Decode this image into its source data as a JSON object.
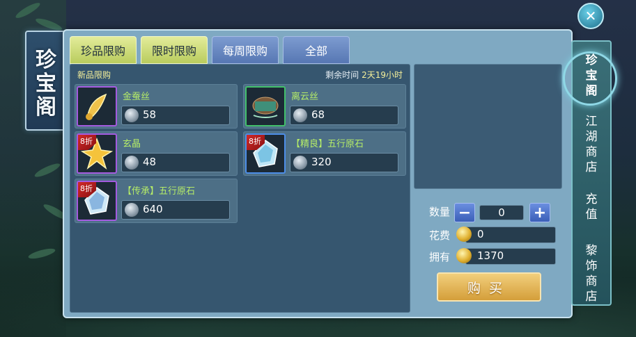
{
  "title": [
    "珍",
    "宝",
    "阁"
  ],
  "tabs": [
    {
      "label": "珍品限购",
      "active": true
    },
    {
      "label": "限时限购",
      "active": true
    },
    {
      "label": "每周限购",
      "active": false
    },
    {
      "label": "全部",
      "active": false
    }
  ],
  "list": {
    "header": "新品限购",
    "remaining_label": "剩余时间",
    "remaining_value": "2天19小时"
  },
  "items": [
    {
      "name": "金蚕丝",
      "price": "58",
      "badge": "",
      "icon": "golden-silk-icon",
      "rarity": "purple"
    },
    {
      "name": "离云丝",
      "price": "68",
      "badge": "",
      "icon": "cloud-silk-spool-icon",
      "rarity": "green"
    },
    {
      "name": "玄晶",
      "price": "48",
      "badge": "8折",
      "icon": "gold-crystal-star-icon",
      "rarity": "purple"
    },
    {
      "name": "【精良】五行原石",
      "price": "320",
      "badge": "8折",
      "icon": "blue-gem-icon",
      "rarity": "blue"
    },
    {
      "name": "【传承】五行原石",
      "price": "640",
      "badge": "8折",
      "icon": "purple-gem-icon",
      "rarity": "purple"
    }
  ],
  "purchase": {
    "qty_label": "数量",
    "qty_value": "0",
    "minus": "−",
    "plus": "+",
    "cost_label": "花费",
    "cost_value": "0",
    "own_label": "拥有",
    "own_value": "1370",
    "buy_label": "购买"
  },
  "sidenav": [
    {
      "label": [
        "珍",
        "宝",
        "阁"
      ],
      "active": true
    },
    {
      "label": [
        "江",
        "湖",
        "商",
        "店"
      ],
      "active": false
    },
    {
      "label": [
        "充",
        "值"
      ],
      "active": false
    },
    {
      "label": [
        "黎",
        "饰",
        "商",
        "店"
      ],
      "active": false
    }
  ],
  "close": "✕",
  "colors": {
    "accent_green": "#b5ec68",
    "tab_active": "#d7e285",
    "tab_normal": "#6a8acb",
    "buy_gold": "#e3b65a"
  }
}
